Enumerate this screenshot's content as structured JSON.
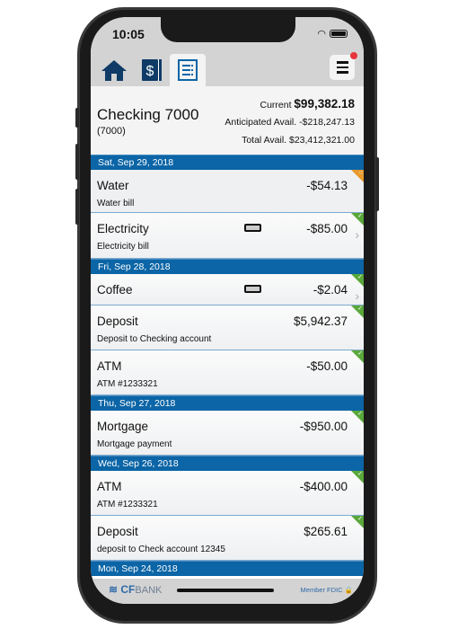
{
  "status": {
    "time": "10:05"
  },
  "tabs": [
    {
      "icon": "home-icon"
    },
    {
      "icon": "dollar-accounts-icon"
    },
    {
      "icon": "transactions-list-icon",
      "active": true
    }
  ],
  "menu": {
    "icon": "hamburger-menu-icon",
    "has_notification": true
  },
  "account": {
    "name": "Checking 7000",
    "number": "(7000)",
    "current_label": "Current",
    "current": "$99,382.18",
    "anticipated_label": "Anticipated Avail.",
    "anticipated": "-$218,247.13",
    "total_label": "Total Avail.",
    "total": "$23,412,321.00"
  },
  "groups": [
    {
      "date": "Sat, Sep 29, 2018",
      "items": [
        {
          "title": "Water",
          "desc": "Water bill",
          "amount": "-$54.13",
          "status": "pending",
          "receipt": false,
          "chevron": false
        },
        {
          "title": "Electricity",
          "desc": "Electricity bill",
          "amount": "-$85.00",
          "status": "cleared",
          "receipt": true,
          "chevron": true
        }
      ]
    },
    {
      "date": "Fri, Sep 28, 2018",
      "items": [
        {
          "title": "Coffee",
          "desc": "",
          "amount": "-$2.04",
          "status": "cleared",
          "receipt": true,
          "chevron": true
        },
        {
          "title": "Deposit",
          "desc": "Deposit to Checking account",
          "amount": "$5,942.37",
          "status": "cleared"
        },
        {
          "title": "ATM",
          "desc": "ATM #1233321",
          "amount": "-$50.00",
          "status": "cleared"
        }
      ]
    },
    {
      "date": "Thu, Sep 27, 2018",
      "items": [
        {
          "title": "Mortgage",
          "desc": "Mortgage payment",
          "amount": "-$950.00",
          "status": "cleared"
        }
      ]
    },
    {
      "date": "Wed, Sep 26, 2018",
      "items": [
        {
          "title": "ATM",
          "desc": "ATM #1233321",
          "amount": "-$400.00",
          "status": "cleared"
        },
        {
          "title": "Deposit",
          "desc": "deposit to Check account 12345",
          "amount": "$265.61",
          "status": "cleared"
        }
      ]
    },
    {
      "date": "Mon, Sep 24, 2018",
      "items": []
    }
  ],
  "footer": {
    "logo": "CFBANK",
    "fdic": "Member FDIC"
  },
  "colors": {
    "accent": "#0b65a6",
    "cleared": "#5aa83a",
    "pending": "#e89a2c",
    "icon": "#0f3b66"
  }
}
